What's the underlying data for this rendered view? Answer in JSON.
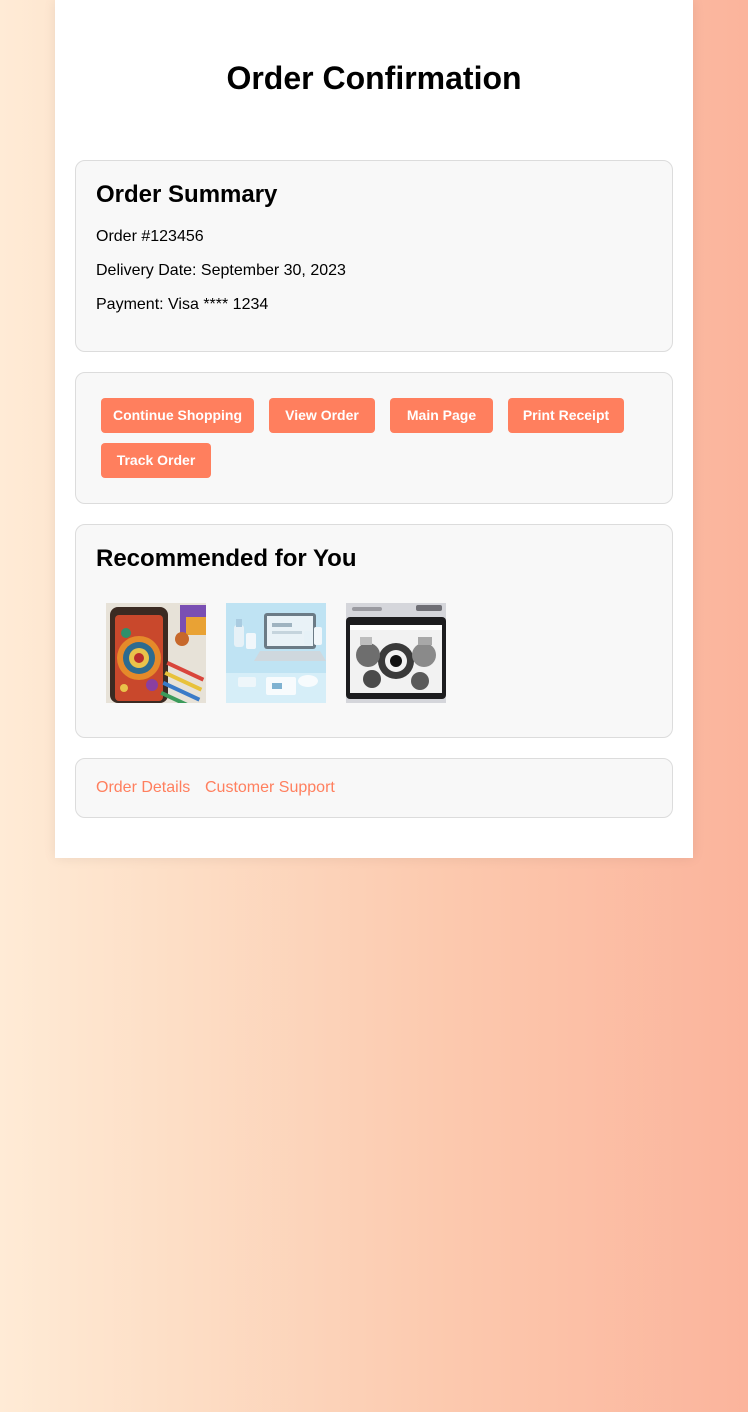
{
  "page": {
    "title": "Order Confirmation"
  },
  "summary": {
    "heading": "Order Summary",
    "order_number": "Order #123456",
    "delivery": "Delivery Date: September 30, 2023",
    "payment": "Payment: Visa **** 1234"
  },
  "actions": {
    "continue_shopping": "Continue Shopping",
    "view_order": "View Order",
    "main_page": "Main Page",
    "print_receipt": "Print Receipt",
    "track_order": "Track Order"
  },
  "recommendations": {
    "heading": "Recommended for You",
    "items": [
      {
        "image": "mandala-phone-art-supplies"
      },
      {
        "image": "laptop-office-accessories"
      },
      {
        "image": "monochrome-tablet-illustration"
      }
    ]
  },
  "footer_links": {
    "order_details": "Order Details",
    "customer_support": "Customer Support"
  },
  "colors": {
    "accent": "#ff7f5e",
    "card_bg": "#f8f8f8",
    "card_border": "#dcdcdc",
    "gradient_start": "#ffebd6",
    "gradient_end": "#fbb49c"
  }
}
